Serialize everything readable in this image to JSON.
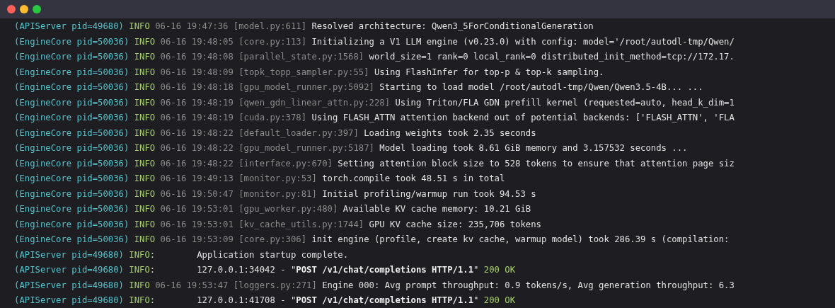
{
  "window": {
    "controls": [
      {
        "kind": "close"
      },
      {
        "kind": "minimize"
      },
      {
        "kind": "zoom"
      }
    ]
  },
  "log_lines": [
    {
      "kind": "log",
      "source": "(APIServer pid=49680)",
      "level": "INFO",
      "timestamp": "06-16 19:47:36",
      "location": "[model.py:611]",
      "message": "Resolved architecture: Qwen3_5ForConditionalGeneration"
    },
    {
      "kind": "log",
      "source": "(EngineCore pid=50036)",
      "level": "INFO",
      "timestamp": "06-16 19:48:05",
      "location": "[core.py:113]",
      "message": "Initializing a V1 LLM engine (v0.23.0) with config: model='/root/autodl-tmp/Qwen/"
    },
    {
      "kind": "log",
      "source": "(EngineCore pid=50036)",
      "level": "INFO",
      "timestamp": "06-16 19:48:08",
      "location": "[parallel_state.py:1568]",
      "message": "world_size=1 rank=0 local_rank=0 distributed_init_method=tcp://172.17."
    },
    {
      "kind": "log",
      "source": "(EngineCore pid=50036)",
      "level": "INFO",
      "timestamp": "06-16 19:48:09",
      "location": "[topk_topp_sampler.py:55]",
      "message": "Using FlashInfer for top-p & top-k sampling."
    },
    {
      "kind": "log",
      "source": "(EngineCore pid=50036)",
      "level": "INFO",
      "timestamp": "06-16 19:48:18",
      "location": "[gpu_model_runner.py:5092]",
      "message": "Starting to load model /root/autodl-tmp/Qwen/Qwen3.5-4B... ..."
    },
    {
      "kind": "log",
      "source": "(EngineCore pid=50036)",
      "level": "INFO",
      "timestamp": "06-16 19:48:19",
      "location": "[qwen_gdn_linear_attn.py:228]",
      "message": "Using Triton/FLA GDN prefill kernel (requested=auto, head_k_dim=1"
    },
    {
      "kind": "log",
      "source": "(EngineCore pid=50036)",
      "level": "INFO",
      "timestamp": "06-16 19:48:19",
      "location": "[cuda.py:378]",
      "message": "Using FLASH_ATTN attention backend out of potential backends: ['FLASH_ATTN', 'FLA"
    },
    {
      "kind": "log",
      "source": "(EngineCore pid=50036)",
      "level": "INFO",
      "timestamp": "06-16 19:48:22",
      "location": "[default_loader.py:397]",
      "message": "Loading weights took 2.35 seconds"
    },
    {
      "kind": "log",
      "source": "(EngineCore pid=50036)",
      "level": "INFO",
      "timestamp": "06-16 19:48:22",
      "location": "[gpu_model_runner.py:5187]",
      "message": "Model loading took 8.61 GiB memory and 3.157532 seconds ..."
    },
    {
      "kind": "log",
      "source": "(EngineCore pid=50036)",
      "level": "INFO",
      "timestamp": "06-16 19:48:22",
      "location": "[interface.py:670]",
      "message": "Setting attention block size to 528 tokens to ensure that attention page siz"
    },
    {
      "kind": "log",
      "source": "(EngineCore pid=50036)",
      "level": "INFO",
      "timestamp": "06-16 19:49:13",
      "location": "[monitor.py:53]",
      "message": "torch.compile took 48.51 s in total"
    },
    {
      "kind": "log",
      "source": "(EngineCore pid=50036)",
      "level": "INFO",
      "timestamp": "06-16 19:50:47",
      "location": "[monitor.py:81]",
      "message": "Initial profiling/warmup run took 94.53 s"
    },
    {
      "kind": "log",
      "source": "(EngineCore pid=50036)",
      "level": "INFO",
      "timestamp": "06-16 19:53:01",
      "location": "[gpu_worker.py:480]",
      "message": "Available KV cache memory: 10.21 GiB"
    },
    {
      "kind": "log",
      "source": "(EngineCore pid=50036)",
      "level": "INFO",
      "timestamp": "06-16 19:53:01",
      "location": "[kv_cache_utils.py:1744]",
      "message": "GPU KV cache size: 235,706 tokens"
    },
    {
      "kind": "log",
      "source": "(EngineCore pid=50036)",
      "level": "INFO",
      "timestamp": "06-16 19:53:09",
      "location": "[core.py:306]",
      "message": "init engine (profile, create kv cache, warmup model) took 286.39 s (compilation:"
    },
    {
      "kind": "access",
      "source": "(APIServer pid=49680)",
      "level": "INFO",
      "separator": ":",
      "message": "Application startup complete."
    },
    {
      "kind": "access",
      "source": "(APIServer pid=49680)",
      "level": "INFO",
      "separator": ":",
      "message": "127.0.0.1:34042 - \"**POST /v1/chat/completions HTTP/1.1**\"",
      "status": "200 OK"
    },
    {
      "kind": "log",
      "source": "(APIServer pid=49680)",
      "level": "INFO",
      "timestamp": "06-16 19:53:47",
      "location": "[loggers.py:271]",
      "message": "Engine 000: Avg prompt throughput: 0.9 tokens/s, Avg generation throughput: 6.3"
    },
    {
      "kind": "access",
      "source": "(APIServer pid=49680)",
      "level": "INFO",
      "separator": ":",
      "message": "127.0.0.1:41708 - \"**POST /v1/chat/completions HTTP/1.1**\"",
      "status": "200 OK"
    }
  ]
}
